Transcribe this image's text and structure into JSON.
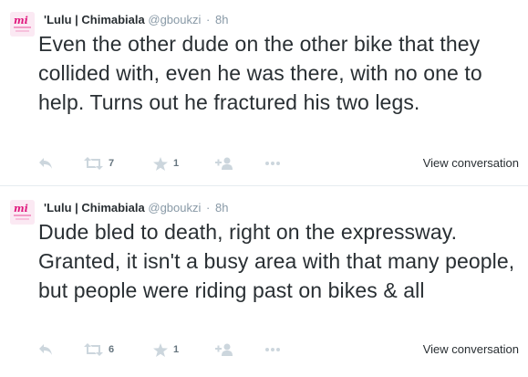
{
  "tweets": [
    {
      "display_name": "'Lulu | Chimabiala",
      "username": "@gboukzi",
      "time": "8h",
      "text": "Even the other dude on the other bike that they collided with, even he was there, with no one to help. Turns out he fractured his two legs.",
      "retweets": "7",
      "favorites": "1",
      "view_conversation": "View conversation"
    },
    {
      "display_name": "'Lulu | Chimabiala",
      "username": "@gboukzi",
      "time": "8h",
      "text": "Dude bled to death, right on the expressway. Granted, it isn't a busy area with that many people, but people were riding past on bikes & all",
      "retweets": "6",
      "favorites": "1",
      "view_conversation": "View conversation"
    }
  ],
  "icons": {
    "reply": "reply-icon",
    "retweet": "retweet-icon",
    "favorite": "star-icon",
    "follow": "follow-icon",
    "more": "more-icon"
  },
  "colors": {
    "text": "#292f33",
    "muted": "#8899a6",
    "icon": "#ccd6dd",
    "avatar_pink": "#e0197e"
  }
}
